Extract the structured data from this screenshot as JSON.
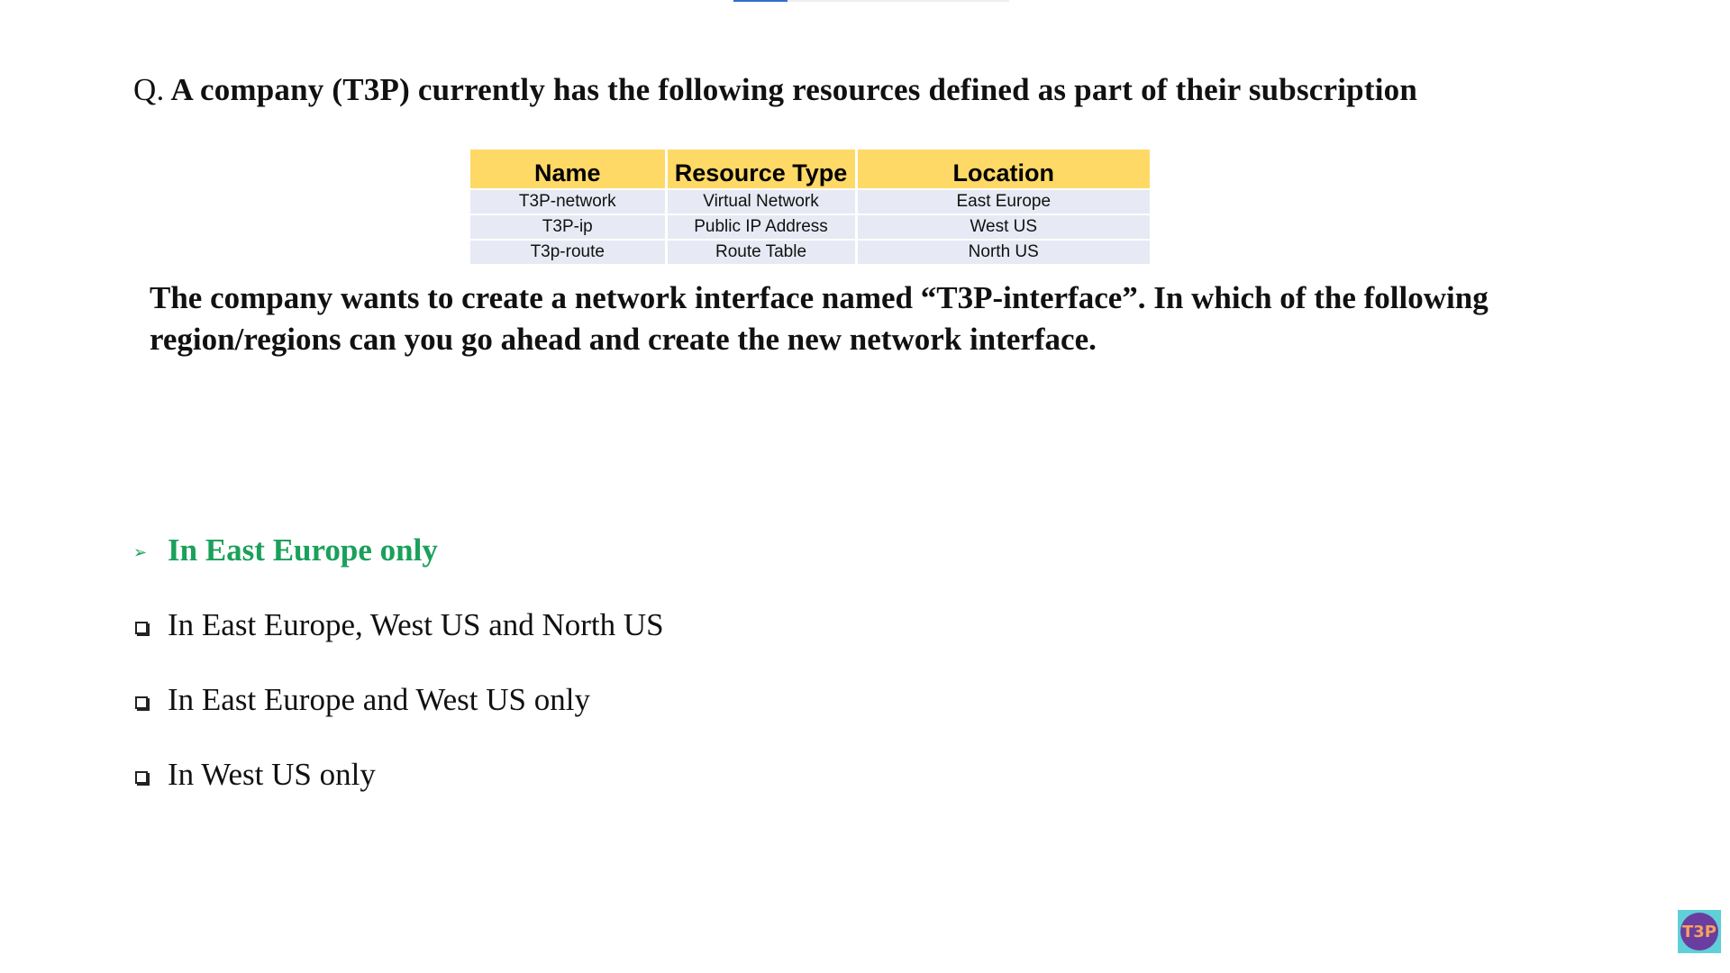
{
  "question": {
    "prefix": "Q.",
    "text": "A company (T3P) currently has the following resources defined as part of their subscription"
  },
  "table": {
    "headers": [
      "Name",
      "Resource Type",
      "Location"
    ],
    "rows": [
      [
        "T3P-network",
        "Virtual Network",
        "East Europe"
      ],
      [
        "T3P-ip",
        "Public IP Address",
        "West US"
      ],
      [
        "T3p-route",
        "Route Table",
        "North US"
      ]
    ],
    "colors": {
      "header_bg": "#ffd966",
      "row_bg": "#e7eaf4"
    }
  },
  "statement": "The company wants to create a network interface named “T3P-interface”. In which of the following region/regions can you go ahead and create the new network interface.",
  "options": [
    {
      "marker": "arrow",
      "text": "In East Europe only",
      "correct": true
    },
    {
      "marker": "box",
      "text": "In East Europe, West US and North US",
      "correct": false
    },
    {
      "marker": "box",
      "text": "In East Europe and West US only",
      "correct": false
    },
    {
      "marker": "box",
      "text": "In West US only",
      "correct": false
    }
  ],
  "colors": {
    "correct_answer": "#1aa05a",
    "top_bar_accent": "#2f6fd0"
  },
  "logo": {
    "text": "T3P",
    "icon": "t3p-logo-icon"
  }
}
